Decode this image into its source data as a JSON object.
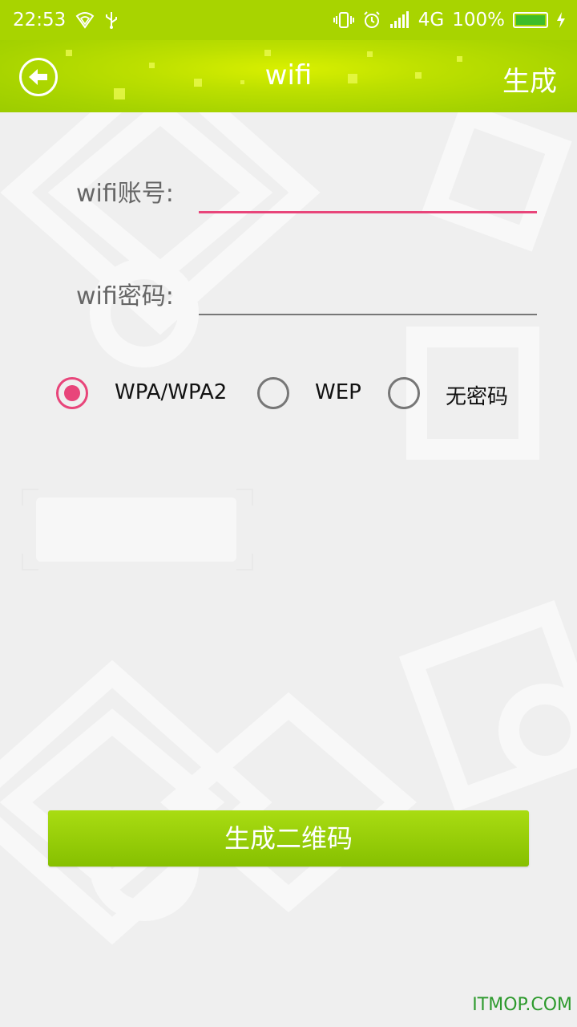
{
  "status_bar": {
    "time": "22:53",
    "network": "4G",
    "battery": "100%",
    "icons": [
      "wifi-hotspot-icon",
      "usb-icon",
      "vibrate-icon",
      "alarm-icon",
      "signal-icon",
      "battery-icon",
      "charging-icon"
    ]
  },
  "app_bar": {
    "title": "wifi",
    "action_label": "生成",
    "back_icon": "back-arrow-icon"
  },
  "form": {
    "account_label": "wifi账号:",
    "account_value": "",
    "password_label": "wifi密码:",
    "password_value": ""
  },
  "security_options": [
    {
      "label": "WPA/WPA2",
      "checked": true
    },
    {
      "label": "WEP",
      "checked": false
    },
    {
      "label": "无密码",
      "checked": false
    }
  ],
  "generate_button_label": "生成二维码",
  "watermark_text": "ITMOP.COM",
  "colors": {
    "accent": "#e8457a",
    "app_bar": "#a8d400",
    "button": "#95cc08",
    "background": "#efefef"
  }
}
